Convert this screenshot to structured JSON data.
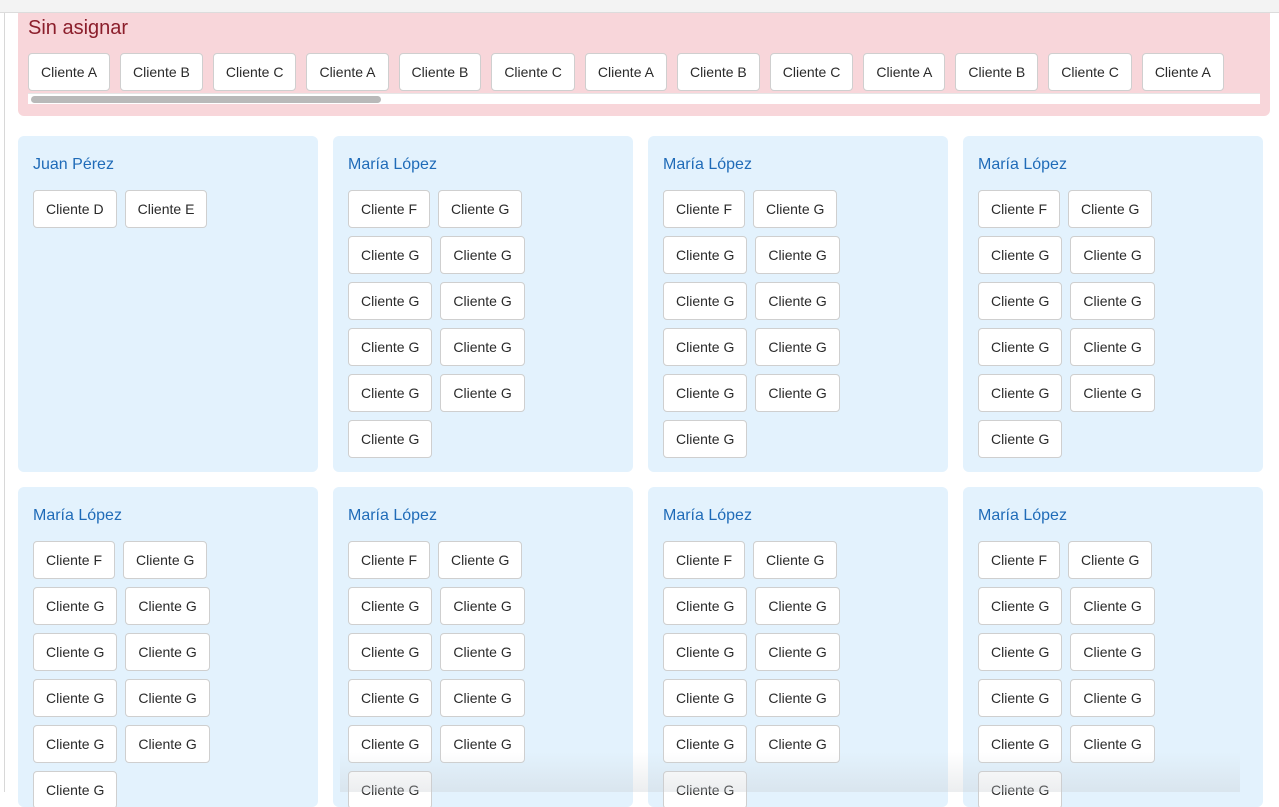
{
  "unassigned": {
    "title": "Sin asignar",
    "chips": [
      "Cliente A",
      "Cliente B",
      "Cliente C",
      "Cliente A",
      "Cliente B",
      "Cliente C",
      "Cliente A",
      "Cliente B",
      "Cliente C",
      "Cliente A",
      "Cliente B",
      "Cliente C",
      "Cliente A"
    ]
  },
  "cards": [
    {
      "title": "Juan Pérez",
      "rows": [
        [
          "Cliente D",
          "Cliente E"
        ]
      ]
    },
    {
      "title": "María López",
      "rows": [
        [
          "Cliente F",
          "Cliente G"
        ],
        [
          "Cliente G",
          "Cliente G"
        ],
        [
          "Cliente G",
          "Cliente G"
        ],
        [
          "Cliente G",
          "Cliente G"
        ],
        [
          "Cliente G",
          "Cliente G"
        ],
        [
          "Cliente G"
        ]
      ]
    },
    {
      "title": "María López",
      "rows": [
        [
          "Cliente F",
          "Cliente G"
        ],
        [
          "Cliente G",
          "Cliente G"
        ],
        [
          "Cliente G",
          "Cliente G"
        ],
        [
          "Cliente G",
          "Cliente G"
        ],
        [
          "Cliente G",
          "Cliente G"
        ],
        [
          "Cliente G"
        ]
      ]
    },
    {
      "title": "María López",
      "rows": [
        [
          "Cliente F",
          "Cliente G"
        ],
        [
          "Cliente G",
          "Cliente G"
        ],
        [
          "Cliente G",
          "Cliente G"
        ],
        [
          "Cliente G",
          "Cliente G"
        ],
        [
          "Cliente G",
          "Cliente G"
        ],
        [
          "Cliente G"
        ]
      ]
    },
    {
      "title": "María López",
      "rows": [
        [
          "Cliente F",
          "Cliente G"
        ],
        [
          "Cliente G",
          "Cliente G"
        ],
        [
          "Cliente G",
          "Cliente G"
        ],
        [
          "Cliente G",
          "Cliente G"
        ],
        [
          "Cliente G",
          "Cliente G"
        ],
        [
          "Cliente G"
        ]
      ]
    },
    {
      "title": "María López",
      "rows": [
        [
          "Cliente F",
          "Cliente G"
        ],
        [
          "Cliente G",
          "Cliente G"
        ],
        [
          "Cliente G",
          "Cliente G"
        ],
        [
          "Cliente G",
          "Cliente G"
        ],
        [
          "Cliente G",
          "Cliente G"
        ],
        [
          "Cliente G"
        ]
      ]
    },
    {
      "title": "María López",
      "rows": [
        [
          "Cliente F",
          "Cliente G"
        ],
        [
          "Cliente G",
          "Cliente G"
        ],
        [
          "Cliente G",
          "Cliente G"
        ],
        [
          "Cliente G",
          "Cliente G"
        ],
        [
          "Cliente G",
          "Cliente G"
        ],
        [
          "Cliente G"
        ]
      ]
    },
    {
      "title": "María López",
      "rows": [
        [
          "Cliente F",
          "Cliente G"
        ],
        [
          "Cliente G",
          "Cliente G"
        ],
        [
          "Cliente G",
          "Cliente G"
        ],
        [
          "Cliente G",
          "Cliente G"
        ],
        [
          "Cliente G",
          "Cliente G"
        ],
        [
          "Cliente G"
        ]
      ]
    }
  ],
  "colors": {
    "unassigned_bg": "#f8d6da",
    "unassigned_title": "#8b1e2b",
    "card_bg": "#e3f2fd",
    "card_title": "#1f6bb8"
  }
}
